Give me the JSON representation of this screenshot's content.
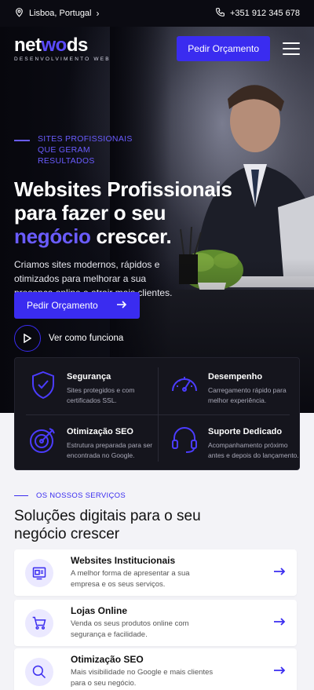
{
  "topbar": {
    "location": "Lisboa, Portugal",
    "phone": "+351 912 345 678"
  },
  "brand": {
    "logo_part1": "net",
    "logo_part2": "wo",
    "logo_part3": "ds",
    "tagline": "DESENVOLVIMENTO WEB"
  },
  "header": {
    "quote_button": "Pedir Orçamento"
  },
  "hero": {
    "eyebrow": "SITES PROFISSIONAIS QUE GERAM RESULTADOS",
    "title_line1": "Websites Profissionais",
    "title_line2": "para fazer o seu",
    "title_accent": "negócio",
    "title_end": " crescer.",
    "description": "Criamos sites modernos, rápidos e otimizados para melhorar a sua presença online e atrair mais clientes.",
    "cta": "Pedir Orçamento",
    "how": "Ver como funciona"
  },
  "features": [
    {
      "icon": "shield-check-icon",
      "title": "Segurança",
      "desc": "Sites protegidos e com certificados SSL."
    },
    {
      "icon": "speedometer-icon",
      "title": "Desempenho",
      "desc": "Carregamento rápido para melhor experiência."
    },
    {
      "icon": "target-icon",
      "title": "Otimização SEO",
      "desc": "Estrutura preparada para ser encontrada no Google."
    },
    {
      "icon": "headset-icon",
      "title": "Suporte Dedicado",
      "desc": "Acompanhamento próximo antes e depois do lançamento."
    }
  ],
  "services": {
    "eyebrow": "OS NOSSOS SERVIÇOS",
    "title": "Soluções digitais para o seu negócio crescer",
    "items": [
      {
        "icon": "website-icon",
        "title": "Websites Institucionais",
        "desc": "A melhor forma de apresentar a sua empresa e os seus serviços."
      },
      {
        "icon": "cart-icon",
        "title": "Lojas Online",
        "desc": "Venda os seus produtos online com segurança e facilidade."
      },
      {
        "icon": "search-icon",
        "title": "Otimização SEO",
        "desc": "Mais visibilidade no Google e mais clientes para o seu negócio."
      }
    ]
  },
  "colors": {
    "accent": "#3a2cf0",
    "accent_light": "#6a5cff",
    "dark": "#0b0b12"
  }
}
